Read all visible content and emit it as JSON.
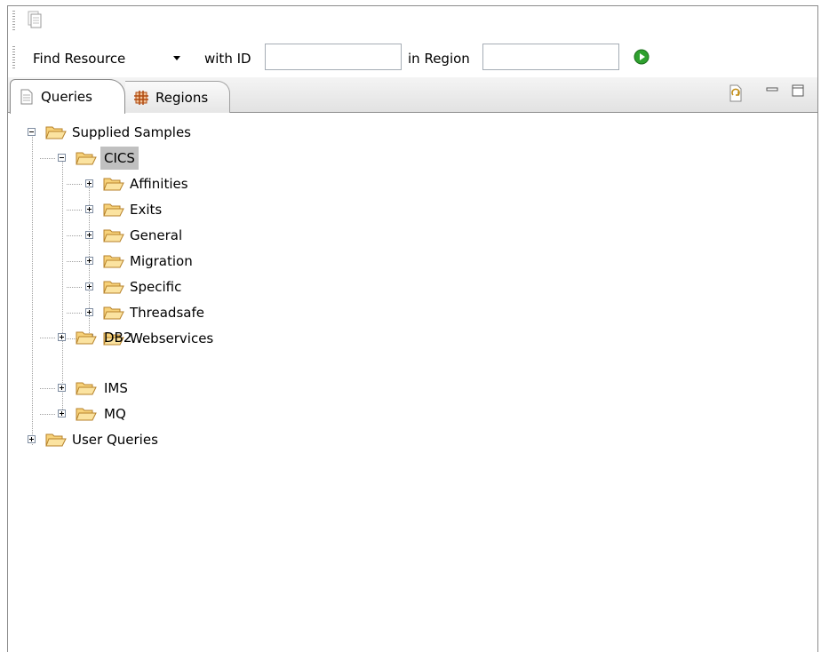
{
  "toolbar": {
    "find_label": "Find Resource",
    "with_id_label": "with ID",
    "with_id_value": "",
    "in_region_label": "in Region",
    "in_region_value": ""
  },
  "tabs": [
    {
      "label": "Queries",
      "icon": "document-icon",
      "active": true
    },
    {
      "label": "Regions",
      "icon": "regions-grid-icon",
      "active": false
    }
  ],
  "tree": {
    "root_1": "Supplied Samples",
    "cics": "CICS",
    "cics_children": [
      "Affinities",
      "Exits",
      "General",
      "Migration",
      "Specific",
      "Threadsafe",
      "Webservices"
    ],
    "db2": "DB2",
    "ims": "IMS",
    "mq": "MQ",
    "root_2": "User Queries"
  },
  "colors": {
    "folder_fill": "#f7d27a",
    "folder_stroke": "#b7822a",
    "go_green": "#2ea02e",
    "selection": "#c0c0c0"
  }
}
